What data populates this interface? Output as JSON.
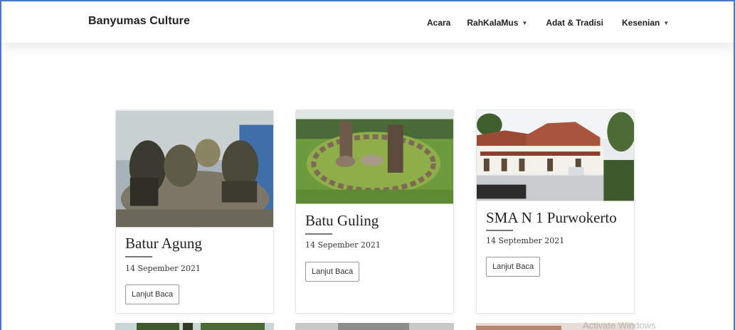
{
  "navbar": {
    "brand": "Banyumas Culture",
    "items": [
      {
        "label": "Acara",
        "dropdown": false
      },
      {
        "label": "RahKalaMus",
        "dropdown": true
      },
      {
        "label": "Adat & Tradisi",
        "dropdown": false
      },
      {
        "label": "Kesenian",
        "dropdown": true
      }
    ]
  },
  "cards": [
    {
      "title": "Batur Agung",
      "date": "14 Sepember 2021",
      "button": "Lanjut Baca"
    },
    {
      "title": "Batu Guling",
      "date": "14 Sepember 2021",
      "button": "Lanjut Baca"
    },
    {
      "title": "SMA N 1 Purwokerto",
      "date": "14 September 2021",
      "button": "Lanjut Baca"
    }
  ],
  "watermark": "Activate Windows"
}
